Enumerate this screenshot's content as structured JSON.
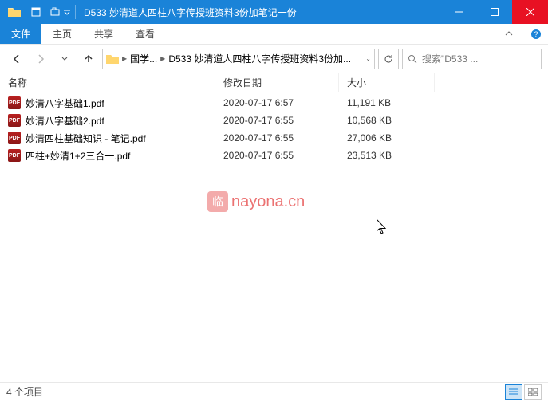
{
  "window": {
    "title": "D533 妙清道人四柱八字传授班资料3份加笔记一份"
  },
  "ribbon": {
    "file": "文件",
    "home": "主页",
    "share": "共享",
    "view": "查看"
  },
  "breadcrumb": {
    "part1": "国学...",
    "part2": "D533 妙清道人四柱八字传授班资料3份加..."
  },
  "search": {
    "placeholder": "搜索\"D533 ..."
  },
  "columns": {
    "name": "名称",
    "date": "修改日期",
    "size": "大小"
  },
  "files": [
    {
      "name": "妙清八字基础1.pdf",
      "date": "2020-07-17 6:57",
      "size": "11,191 KB"
    },
    {
      "name": "妙清八字基础2.pdf",
      "date": "2020-07-17 6:55",
      "size": "10,568 KB"
    },
    {
      "name": "妙清四柱基础知识 - 笔记.pdf",
      "date": "2020-07-17 6:55",
      "size": "27,006 KB"
    },
    {
      "name": "四柱+妙清1+2三合一.pdf",
      "date": "2020-07-17 6:55",
      "size": "23,513 KB"
    }
  ],
  "watermark": "nayona.cn",
  "status": {
    "count": "4 个项目"
  }
}
